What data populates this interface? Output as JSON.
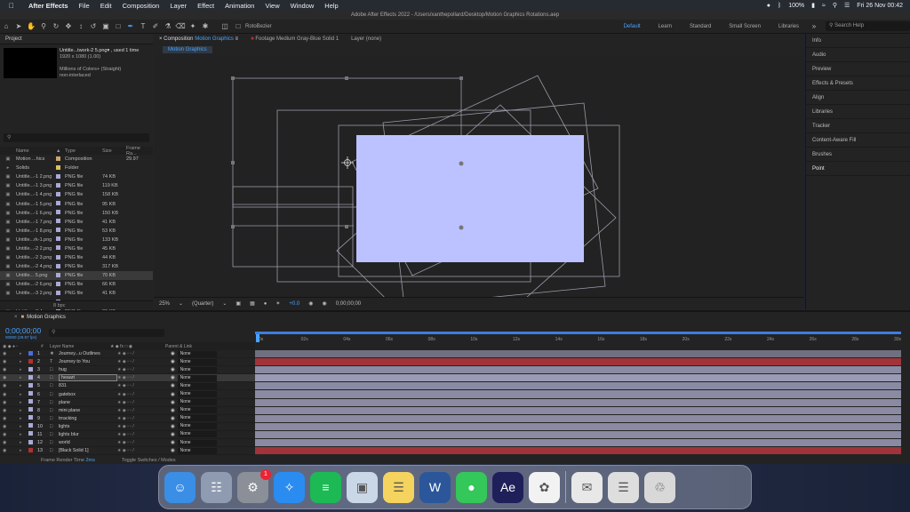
{
  "menubar": {
    "app": "After Effects",
    "items": [
      "File",
      "Edit",
      "Composition",
      "Layer",
      "Effect",
      "Animation",
      "View",
      "Window",
      "Help"
    ],
    "battery": "100%",
    "clock": "Fri 26 Nov  00:42"
  },
  "window_title": "Adobe After Effects 2022 - /Users/xanthepollard/Desktop/Motion Graphics Rotations.aep",
  "toolbar": {
    "rotobezier": "RotoBezier",
    "workspaces": [
      "Default",
      "Learn",
      "Standard",
      "Small Screen",
      "Libraries"
    ],
    "search_placeholder": "Search Help"
  },
  "project": {
    "title": "Project",
    "selected_name": "Untitle...twork-2 5.png▾ , used 1 time",
    "dims": "1920 x 1080 (1.00)",
    "colors": "Millions of Colors+ (Straight)",
    "interlace": "non-interlaced",
    "search_placeholder": "",
    "columns": [
      "Name",
      "",
      "Type",
      "Size",
      "Frame Ra..."
    ],
    "rows": [
      {
        "name": "Motion ...hics",
        "type": "Composition",
        "size": "",
        "fr": "29.97",
        "color": "#c8a86a"
      },
      {
        "name": "Solids",
        "type": "Folder",
        "size": "",
        "fr": "",
        "color": "#d9c35b"
      },
      {
        "name": "Untitle...-1 2.png",
        "type": "PNG file",
        "size": "74 KB",
        "fr": "",
        "color": "#a9a9d8"
      },
      {
        "name": "Untitle...-1 3.png",
        "type": "PNG file",
        "size": "119 KB",
        "fr": "",
        "color": "#a9a9d8"
      },
      {
        "name": "Untitle...-1 4.png",
        "type": "PNG file",
        "size": "158 KB",
        "fr": "",
        "color": "#a9a9d8"
      },
      {
        "name": "Untitle...-1 5.png",
        "type": "PNG file",
        "size": "95 KB",
        "fr": "",
        "color": "#a9a9d8"
      },
      {
        "name": "Untitle...-1 6.png",
        "type": "PNG file",
        "size": "150 KB",
        "fr": "",
        "color": "#a9a9d8"
      },
      {
        "name": "Untitle...-1 7.png",
        "type": "PNG file",
        "size": "41 KB",
        "fr": "",
        "color": "#a9a9d8"
      },
      {
        "name": "Untitle...-1 8.png",
        "type": "PNG file",
        "size": "53 KB",
        "fr": "",
        "color": "#a9a9d8"
      },
      {
        "name": "Untitle...rk-1.png",
        "type": "PNG file",
        "size": "133 KB",
        "fr": "",
        "color": "#a9a9d8"
      },
      {
        "name": "Untitle...-2 2.png",
        "type": "PNG file",
        "size": "45 KB",
        "fr": "",
        "color": "#a9a9d8"
      },
      {
        "name": "Untitle...-2 3.png",
        "type": "PNG file",
        "size": "44 KB",
        "fr": "",
        "color": "#a9a9d8"
      },
      {
        "name": "Untitle...-2 4.png",
        "type": "PNG file",
        "size": "317 KB",
        "fr": "",
        "color": "#a9a9d8"
      },
      {
        "name": "Untitle... 5.png",
        "type": "PNG file",
        "size": "70 KB",
        "fr": "",
        "color": "#a9a9d8",
        "selected": true
      },
      {
        "name": "Untitle...-2 6.png",
        "type": "PNG file",
        "size": "66 KB",
        "fr": "",
        "color": "#a9a9d8"
      },
      {
        "name": "Untitle...-3 2.png",
        "type": "PNG file",
        "size": "41 KB",
        "fr": "",
        "color": "#a9a9d8"
      },
      {
        "name": "Untitle...-3 3.png",
        "type": "PNG file",
        "size": "37 KB",
        "fr": "",
        "color": "#a9a9d8"
      },
      {
        "name": "Untitle...-3 4.png",
        "type": "PNG file",
        "size": "39 KB",
        "fr": "",
        "color": "#a9a9d8"
      },
      {
        "name": "Untitle...rk-4.png",
        "type": "PNG file",
        "size": "48 KB",
        "fr": "",
        "color": "#a9a9d8"
      }
    ],
    "footer": "8 bpc"
  },
  "composition": {
    "tab_label": "Composition",
    "tab_name": "Motion Graphics",
    "footage_tab": "Footage Medium Gray-Blue Solid 1",
    "layer_tab": "Layer (none)",
    "sub_tab": "Motion Graphics",
    "zoom": "25%",
    "resolution": "(Quarter)",
    "exposure": "+0.0",
    "timecode": "0;00;00;00",
    "solid_color": "#bcc2ff"
  },
  "right_panels": [
    "Info",
    "Audio",
    "Preview",
    "Effects & Presets",
    "Align",
    "Libraries",
    "Tracker",
    "Content-Aware Fill",
    "Brushes",
    "Point"
  ],
  "timeline": {
    "title": "Motion Graphics",
    "timecode": "0;00;00;00",
    "timecode_sub": "00000 (29.97 fps)",
    "columns": {
      "num": "#",
      "layer_name": "Layer Name",
      "parent": "Parent & Link"
    },
    "ruler": [
      "0s",
      "02s",
      "04s",
      "06s",
      "08s",
      "10s",
      "12s",
      "14s",
      "16s",
      "18s",
      "20s",
      "22s",
      "24s",
      "26s",
      "28s",
      "30s"
    ],
    "layers": [
      {
        "num": "1",
        "type": "★",
        "name": "Journey...u  Outlines",
        "label": "#4b6ed8",
        "parent": "None",
        "track": "#6f7080"
      },
      {
        "num": "2",
        "type": "T",
        "name": "Journey to You",
        "label": "#b03030",
        "parent": "None",
        "track": "#a0343a"
      },
      {
        "num": "3",
        "type": "□",
        "name": "hug",
        "label": "#a9a9d8",
        "parent": "None",
        "track": "#8a8aa2"
      },
      {
        "num": "4",
        "type": "□",
        "name": "heaart",
        "label": "#a9a9d8",
        "parent": "None",
        "track": "#9a9ab4",
        "selected": true
      },
      {
        "num": "5",
        "type": "□",
        "name": "831",
        "label": "#a9a9d8",
        "parent": "None",
        "track": "#8a8aa2"
      },
      {
        "num": "6",
        "type": "□",
        "name": "gatebox",
        "label": "#a9a9d8",
        "parent": "None",
        "track": "#8a8aa2"
      },
      {
        "num": "7",
        "type": "□",
        "name": "plane",
        "label": "#a9a9d8",
        "parent": "None",
        "track": "#8a8aa2"
      },
      {
        "num": "8",
        "type": "□",
        "name": "mini plane",
        "label": "#a9a9d8",
        "parent": "None",
        "track": "#8a8aa2"
      },
      {
        "num": "9",
        "type": "□",
        "name": "trracking",
        "label": "#a9a9d8",
        "parent": "None",
        "track": "#8a8aa2"
      },
      {
        "num": "10",
        "type": "□",
        "name": "lights",
        "label": "#a9a9d8",
        "parent": "None",
        "track": "#8a8aa2"
      },
      {
        "num": "11",
        "type": "□",
        "name": "lights blur",
        "label": "#a9a9d8",
        "parent": "None",
        "track": "#8a8aa2"
      },
      {
        "num": "12",
        "type": "□",
        "name": "world",
        "label": "#a9a9d8",
        "parent": "None",
        "track": "#8a8aa2"
      },
      {
        "num": "13",
        "type": "□",
        "name": "[Black Solid 1]",
        "label": "#b03030",
        "parent": "None",
        "track": "#a0343a"
      }
    ],
    "footer_render": "Frame Render Time",
    "footer_render_val": "2ms",
    "footer_toggle": "Toggle Switches / Modes"
  },
  "dock": {
    "items": [
      {
        "name": "finder-icon",
        "glyph": "☺",
        "color": "#3a8ee6"
      },
      {
        "name": "launchpad-icon",
        "glyph": "☷",
        "color": "#8f9bb0"
      },
      {
        "name": "system-preferences-icon",
        "glyph": "⚙",
        "color": "#8a8f98",
        "badge": "1"
      },
      {
        "name": "safari-icon",
        "glyph": "✧",
        "color": "#2a8cf0"
      },
      {
        "name": "spotify-icon",
        "glyph": "≡",
        "color": "#1db954"
      },
      {
        "name": "preview-icon",
        "glyph": "▣",
        "color": "#c9d7e6"
      },
      {
        "name": "notes-icon",
        "glyph": "☰",
        "color": "#f4d35e"
      },
      {
        "name": "word-icon",
        "glyph": "W",
        "color": "#2b579a"
      },
      {
        "name": "messages-icon",
        "glyph": "●",
        "color": "#34c759"
      },
      {
        "name": "after-effects-icon",
        "glyph": "Ae",
        "color": "#1f1f5a"
      },
      {
        "name": "photos-icon",
        "glyph": "✿",
        "color": "#f2f2f2"
      },
      {
        "name": "downloads-stack-icon",
        "glyph": "✉",
        "color": "#e8e8e8"
      },
      {
        "name": "documents-stack-icon",
        "glyph": "☰",
        "color": "#dedede"
      },
      {
        "name": "trash-icon",
        "glyph": "♲",
        "color": "#d8d8d8"
      }
    ]
  }
}
